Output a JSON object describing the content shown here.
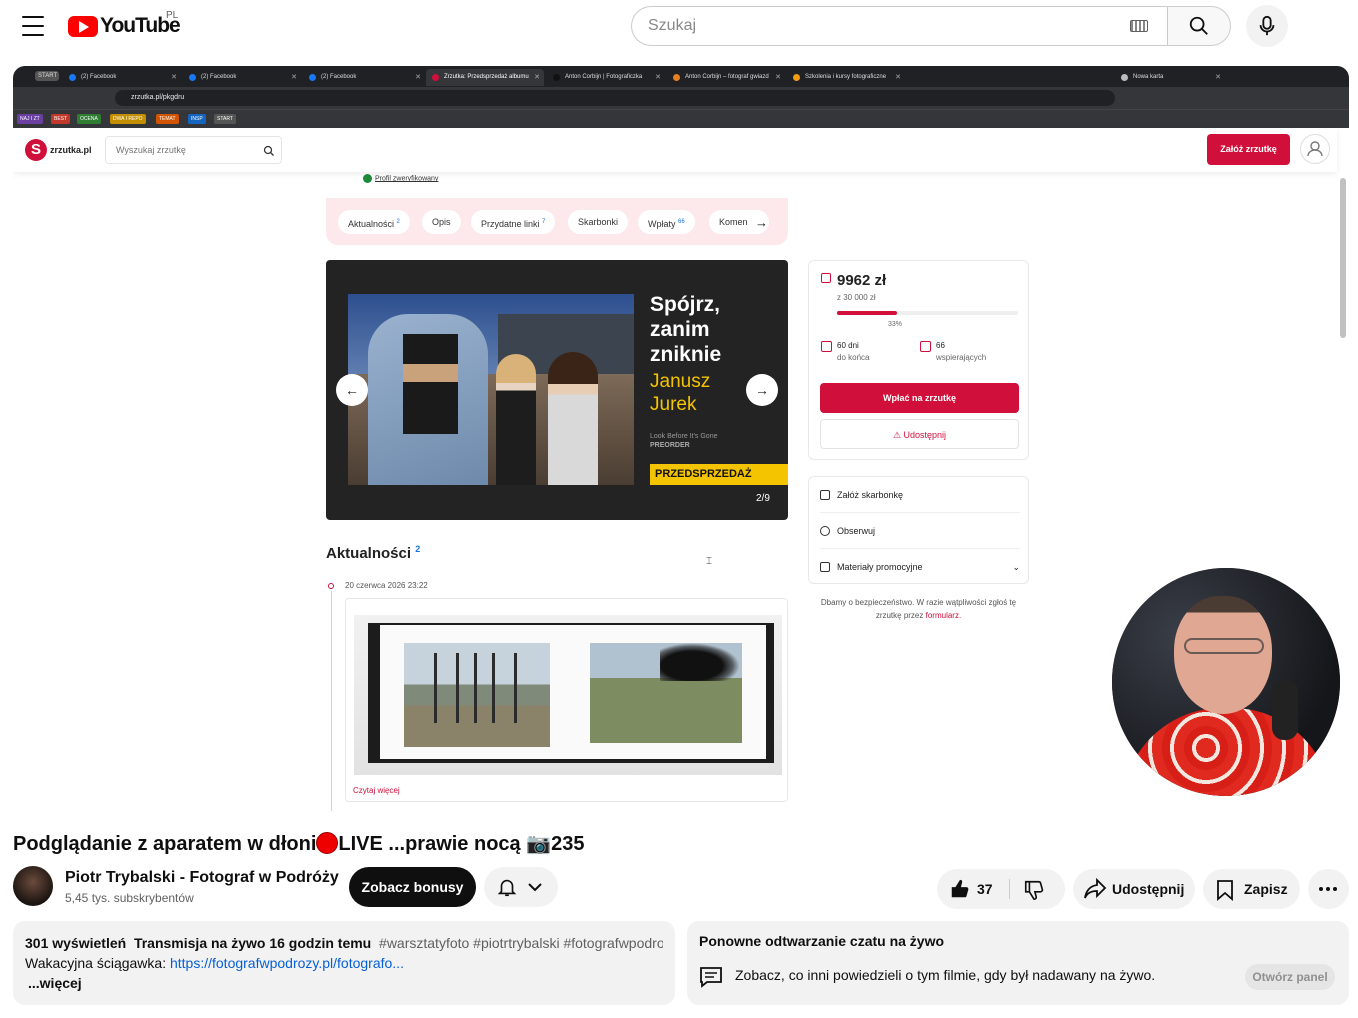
{
  "youtube": {
    "country": "PL",
    "search_placeholder": "Szukaj",
    "video_title": "Podglądanie z aparatem w dłoni",
    "video_title_live": "LIVE ...prawie nocą",
    "video_title_num": "235",
    "channel_name": "Piotr Trybalski - Fotograf w Podróży",
    "subscribers": "5,45 tys. subskrybentów",
    "bonus_label": "Zobacz bonusy",
    "likes": "37",
    "share_label": "Udostępnij",
    "save_label": "Zapisz",
    "description": {
      "views": "301 wyświetleń",
      "when": "Transmisja na żywo 16 godzin temu",
      "tags": "#warsztatyfoto #piotrtrybalski #fotografwpodro…",
      "line2_prefix": "Wakacyjna ściągawka:",
      "link": "https://fotografwpodrozy.pl/fotografo...",
      "more": "...więcej"
    },
    "chat": {
      "title": "Ponowne odtwarzanie czatu na żywo",
      "text": "Zobacz, co inni powiedzieli o tym filmie, gdy był nadawany na żywo.",
      "button": "Otwórz panel"
    }
  },
  "browser": {
    "tabs": [
      "START",
      "(2) Facebook",
      "(2) Facebook",
      "(2) Facebook",
      "Zrzutka: Przedsprzedaż albumu",
      "Anton Corbijn | Fotograficzka",
      "Anton Corbijn – fotograf gwiazd",
      "Szkolenia i kursy fotograficzne",
      "Nowa karta"
    ],
    "url": "zrzutka.pl/pkgdru",
    "bookmarks": [
      "NAJ I ZT",
      "BEST",
      "OCENA",
      "DWA I REPO",
      "TEMAT",
      "INSP",
      "START"
    ],
    "bookmark_colors": [
      "#6a3fa0",
      "#c0392b",
      "#2e7d32",
      "#c28f00",
      "#d35400",
      "#1565c0",
      "#555555"
    ]
  },
  "site": {
    "logo_name": "zrzutka.pl",
    "search_placeholder": "Wyszukaj zrzutkę",
    "create_button": "Załóż zrzutkę",
    "verified": "Profil zweryfikowany",
    "tabs": [
      {
        "label": "Aktualności",
        "badge": "2"
      },
      {
        "label": "Opis",
        "badge": ""
      },
      {
        "label": "Przydatne linki",
        "badge": "7"
      },
      {
        "label": "Skarbonki",
        "badge": ""
      },
      {
        "label": "Wpłaty",
        "badge": "66"
      },
      {
        "label": "Komen",
        "badge": ""
      }
    ],
    "slide": {
      "headline": [
        "Spójrz,",
        "zanim",
        "zniknie"
      ],
      "author": [
        "Janusz",
        "Jurek"
      ],
      "small1": "Look Before It's Gone",
      "small2": "PREORDER",
      "banner": "PRZEDSPRZEDAŻ",
      "counter": "2/9"
    },
    "news_heading": "Aktualności",
    "news_count": "2",
    "news_date": "20 czerwca 2026 23:22",
    "read_more": "Czytaj więcej",
    "fundraiser": {
      "amount": "9962 zł",
      "goal": "z 30 000 zł",
      "progress_pct": 33,
      "progress_label": "33%",
      "days": "60 dni",
      "days_sub": "do końca",
      "supporters": "66",
      "supporters_sub": "wspierających",
      "pay_button": "Wpłać na zrzutkę",
      "share_button": "Udostępnij"
    },
    "options": [
      "Załóż skarbonkę",
      "Obserwuj",
      "Materiały promocyjne"
    ],
    "safety_text": "Dbamy o bezpieczeństwo. W razie wątpliwości zgłoś tę zrzutkę przez",
    "safety_link": "formularz."
  }
}
